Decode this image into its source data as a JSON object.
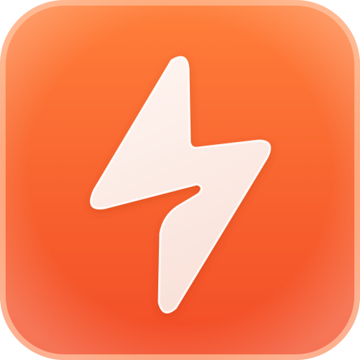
{
  "icon": {
    "name": "lightning-bolt-icon",
    "colors": {
      "background_top": "#FF7F3A",
      "background_bottom": "#F24B26",
      "rim": "#FFB48A",
      "bolt_fill": "#FCEDE8",
      "bolt_edge": "#FFFFFF"
    }
  }
}
